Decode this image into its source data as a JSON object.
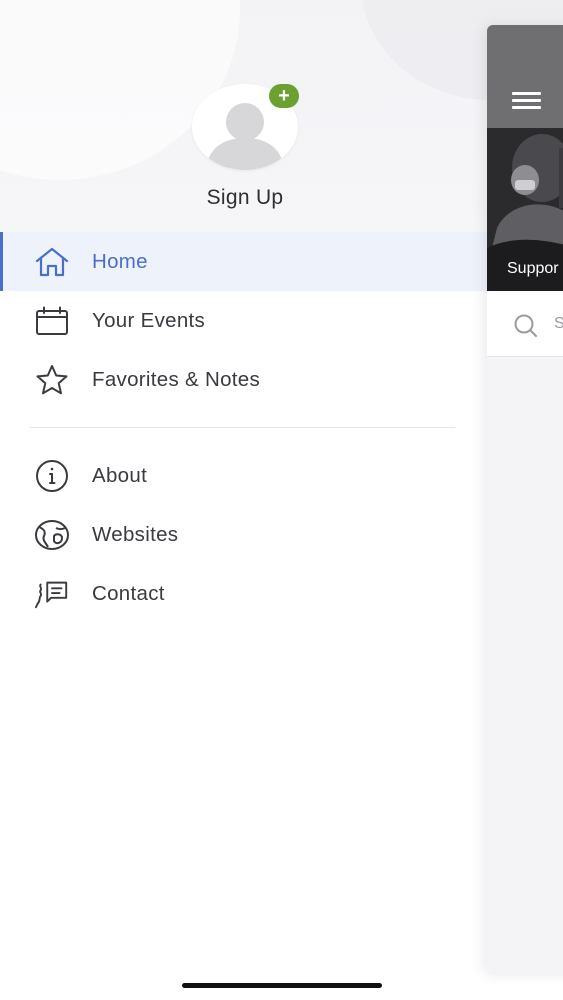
{
  "drawer": {
    "profile": {
      "avatar_icon": "user-avatar-icon",
      "add_icon": "plus-icon",
      "add_badge_color": "#6aa130",
      "signup_label": "Sign Up"
    },
    "primary_items": [
      {
        "label": "Home",
        "icon": "home-icon",
        "active": true
      },
      {
        "label": "Your Events",
        "icon": "calendar-icon",
        "active": false
      },
      {
        "label": "Favorites & Notes",
        "icon": "star-icon",
        "active": false
      }
    ],
    "secondary_items": [
      {
        "label": "About",
        "icon": "info-icon"
      },
      {
        "label": "Websites",
        "icon": "globe-icon"
      },
      {
        "label": "Contact",
        "icon": "chat-icon"
      }
    ],
    "accent_color": "#4a6fc8"
  },
  "main_peek": {
    "menu_icon": "hamburger-menu-icon",
    "banner_caption": "Suppor",
    "search_icon": "search-icon",
    "search_placeholder": "S"
  }
}
